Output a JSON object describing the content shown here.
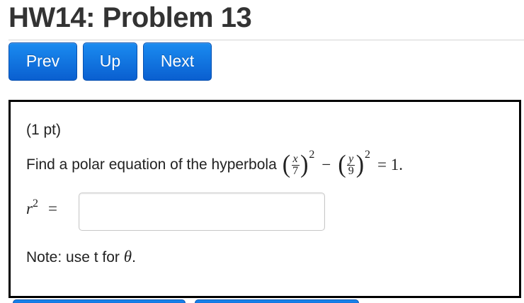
{
  "page": {
    "title": "HW14: Problem 13"
  },
  "nav": {
    "prev_label": "Prev",
    "up_label": "Up",
    "next_label": "Next",
    "button_color": "#1478e6"
  },
  "problem": {
    "points": "(1 pt)",
    "question_text": "Find a polar equation of the hyperbola",
    "equation": {
      "term1_num": "x",
      "term1_den": "7",
      "term2_num": "y",
      "term2_den": "9",
      "exponent": "2",
      "minus": "−",
      "equals": "= 1."
    },
    "answer": {
      "var": "r",
      "exp": "2",
      "eq": "=",
      "value": ""
    },
    "note_text": "Note: use t for",
    "note_symbol": "θ",
    "note_end": "."
  }
}
